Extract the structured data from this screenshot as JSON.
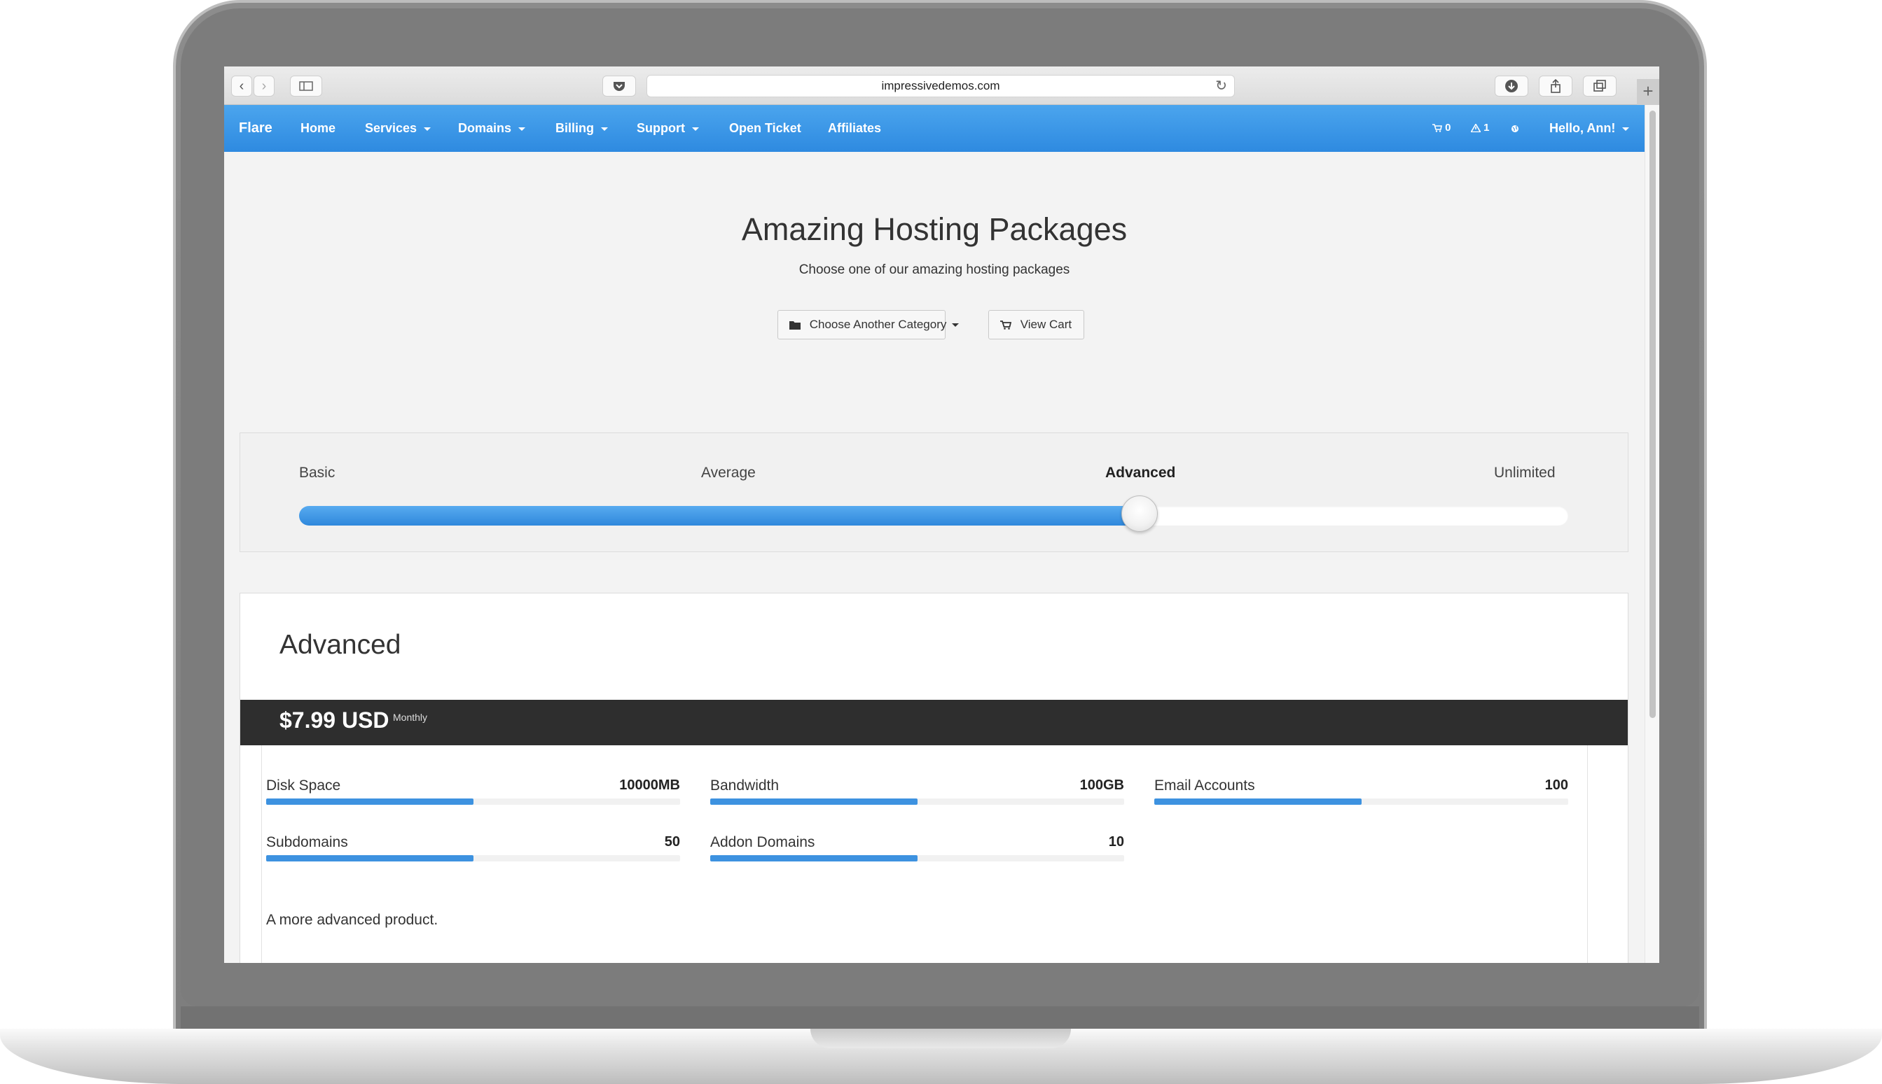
{
  "browser": {
    "url": "impressivedemos.com",
    "back_icon": "‹",
    "forward_icon": "›"
  },
  "nav": {
    "brand": "Flare",
    "items": [
      {
        "label": "Home"
      },
      {
        "label": "Services"
      },
      {
        "label": "Domains"
      },
      {
        "label": "Billing"
      },
      {
        "label": "Support"
      },
      {
        "label": "Open Ticket"
      },
      {
        "label": "Affiliates"
      }
    ],
    "cart_count": "0",
    "alerts_count": "1",
    "user_menu": "Hello, Ann!"
  },
  "hero": {
    "title": "Amazing Hosting Packages",
    "subtitle": "Choose one of our amazing hosting packages",
    "category_button": "Choose Another Category",
    "cart_button": "View Cart"
  },
  "slider": {
    "tiers": [
      "Basic",
      "Average",
      "Advanced",
      "Unlimited"
    ],
    "selected": "Advanced",
    "selected_fraction": 0.662
  },
  "product": {
    "name": "Advanced",
    "price": "$7.99 USD",
    "cycle": "Monthly",
    "features": [
      {
        "label": "Disk Space",
        "value": "10000MB",
        "fill": 0.5
      },
      {
        "label": "Bandwidth",
        "value": "100GB",
        "fill": 0.5
      },
      {
        "label": "Email Accounts",
        "value": "100",
        "fill": 0.5
      },
      {
        "label": "Subdomains",
        "value": "50",
        "fill": 0.5
      },
      {
        "label": "Addon Domains",
        "value": "10",
        "fill": 0.5
      }
    ],
    "description": "A more advanced product."
  },
  "colors": {
    "nav_blue": "#2e8ae0",
    "price_bar": "#2e2e2e",
    "fill_blue": "#3d92e0"
  }
}
